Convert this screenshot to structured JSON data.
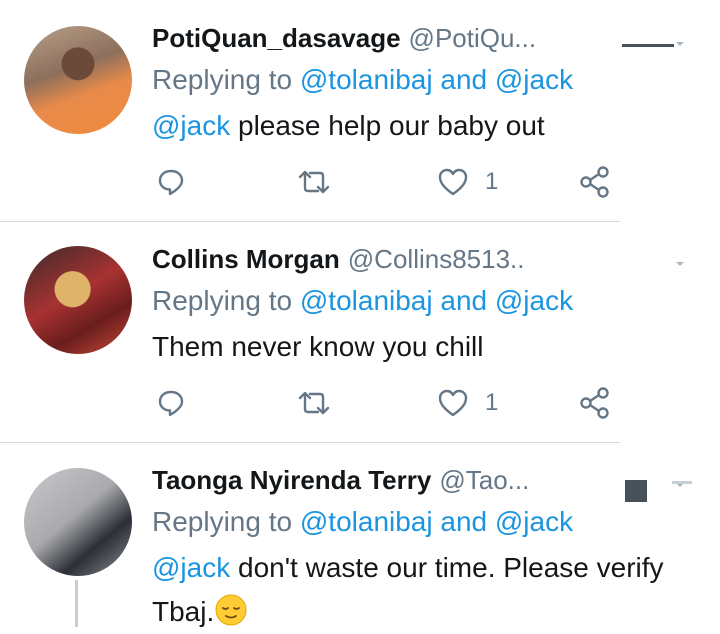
{
  "tweets": [
    {
      "name": "PotiQuan_dasavage",
      "handle": "@PotiQu...",
      "reply_prefix": "Replying to",
      "reply_to": "@tolanibaj and @jack",
      "text_mention": "@jack",
      "text": " please help our baby out",
      "likes": "1"
    },
    {
      "name": "Collins Morgan",
      "handle": "@Collins8513..",
      "reply_prefix": "Replying to",
      "reply_to": "@tolanibaj and @jack",
      "text": "Them never know you  chill",
      "likes": "1"
    },
    {
      "name": "Taonga Nyirenda Terry",
      "handle": "@Tao...",
      "reply_prefix": "Replying to",
      "reply_to": "@tolanibaj and @jack",
      "text_mention": "@jack",
      "text_line1": " don't waste our time. Please verify",
      "text_line2": "Tbaj."
    }
  ],
  "icons": [
    "reply-icon",
    "retweet-icon",
    "like-icon",
    "share-icon",
    "relieved-face-emoji",
    "chevron-down-icon"
  ],
  "colors": {
    "link": "#1b95e0",
    "muted": "#657786",
    "text": "#14171a"
  }
}
